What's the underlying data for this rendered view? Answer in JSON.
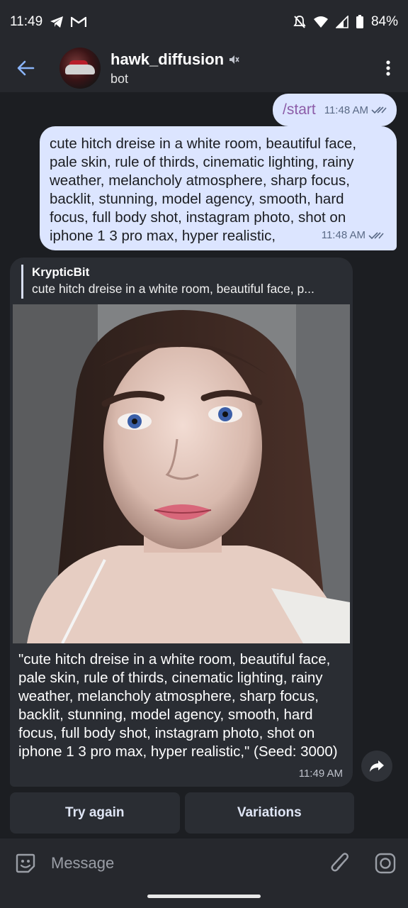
{
  "status_bar": {
    "time": "11:49",
    "battery": "84%",
    "icons": [
      "telegram-icon",
      "gmail-icon",
      "mute-notifications-icon",
      "wifi-icon",
      "signal-icon",
      "battery-icon"
    ]
  },
  "header": {
    "title": "hawk_diffusion",
    "subtitle": "bot",
    "icons": [
      "back-arrow-icon",
      "muted-speaker-icon",
      "more-vert-icon"
    ]
  },
  "messages": {
    "start": {
      "text": "/start",
      "time": "11:48 AM"
    },
    "prompt": {
      "text": "cute hitch dreise in a white room, beautiful face, pale skin, rule of thirds, cinematic lighting, rainy weather, melancholy atmosphere, sharp focus, backlit, stunning, model agency, smooth, hard focus, full body shot, instagram photo, shot on iphone 1 3 pro max, hyper realistic,",
      "time": "11:48 AM"
    },
    "reply": {
      "quote_author": "KrypticBit",
      "quote_text": "cute hitch dreise in a white room, beautiful face, p...",
      "caption": "\"cute hitch dreise in a white room, beautiful face, pale skin, rule of thirds, cinematic lighting, rainy weather, melancholy atmosphere, sharp focus, backlit, stunning, model agency, smooth, hard focus, full body shot, instagram photo, shot on iphone 1 3 pro max, hyper realistic,\" (Seed: 3000)",
      "time": "11:49 AM"
    }
  },
  "keyboard": {
    "try_again": "Try again",
    "variations": "Variations"
  },
  "input": {
    "placeholder": "Message"
  },
  "colors": {
    "outgoing_bubble": "#dce5ff",
    "incoming_bubble": "#2a2d33",
    "background": "#1c1e22",
    "accent": "#8ab4f8"
  }
}
